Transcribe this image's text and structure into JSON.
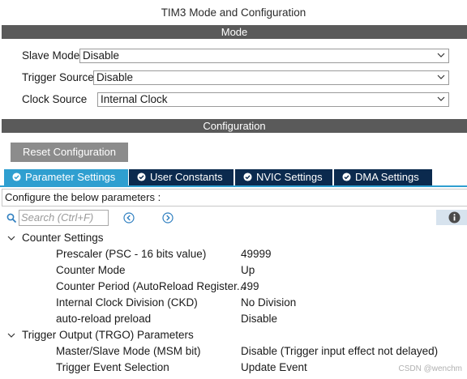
{
  "window": {
    "title": "TIM3 Mode and Configuration"
  },
  "mode_section": {
    "header": "Mode",
    "fields": [
      {
        "label": "Slave Mode",
        "value": "Disable"
      },
      {
        "label": "Trigger Source",
        "value": "Disable"
      },
      {
        "label": "Clock Source",
        "value": "Internal Clock"
      }
    ]
  },
  "config_section": {
    "header": "Configuration",
    "reset_button": "Reset Configuration",
    "tabs": [
      {
        "label": "Parameter Settings",
        "active": true
      },
      {
        "label": "User Constants",
        "active": false
      },
      {
        "label": "NVIC Settings",
        "active": false
      },
      {
        "label": "DMA Settings",
        "active": false
      }
    ],
    "hint": "Configure the below parameters :",
    "search": {
      "placeholder": "Search (Ctrl+F)"
    },
    "groups": [
      {
        "name": "Counter Settings",
        "params": [
          {
            "name": "Prescaler (PSC - 16 bits value)",
            "value": "49999"
          },
          {
            "name": "Counter Mode",
            "value": "Up"
          },
          {
            "name": "Counter Period (AutoReload Register...",
            "value": "499"
          },
          {
            "name": "Internal Clock Division (CKD)",
            "value": "No Division"
          },
          {
            "name": "auto-reload preload",
            "value": "Disable"
          }
        ]
      },
      {
        "name": "Trigger Output (TRGO) Parameters",
        "params": [
          {
            "name": "Master/Slave Mode (MSM bit)",
            "value": "Disable (Trigger input effect not delayed)"
          },
          {
            "name": "Trigger Event Selection",
            "value": "Update Event"
          }
        ]
      }
    ]
  },
  "watermark": "CSDN @wenchm",
  "colors": {
    "active_tab": "#2f9fd0",
    "inactive_tab": "#0b2a4e",
    "section_bar": "#5a5a5a",
    "reset_button": "#8c8c8c"
  },
  "icons": [
    "check-circle-icon",
    "search-icon",
    "arrow-left-circle-icon",
    "arrow-right-circle-icon",
    "info-icon",
    "chevron-down-icon",
    "caret-down-icon"
  ]
}
